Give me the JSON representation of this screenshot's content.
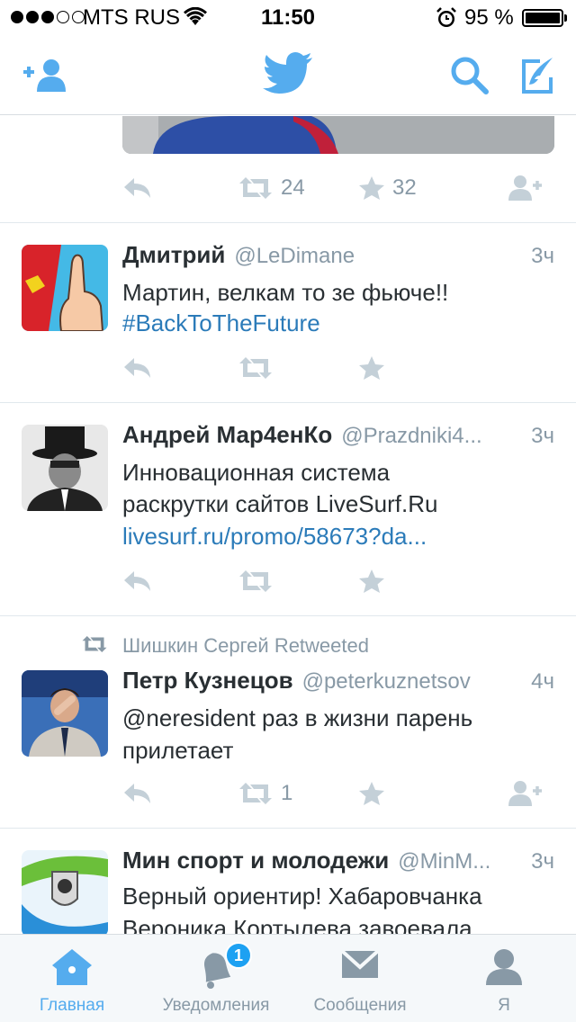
{
  "status_bar": {
    "carrier": "MTS RUS",
    "time": "11:50",
    "battery": "95 %"
  },
  "colors": {
    "accent": "#55acee",
    "text": "#292f33",
    "muted": "#8899a6",
    "link": "#2b7bb9",
    "action_icon": "#c4d0d8"
  },
  "nav": {
    "icons": [
      "add-user-icon",
      "twitter-bird-icon",
      "search-icon",
      "compose-icon"
    ]
  },
  "top_tweet": {
    "retweet_count": "24",
    "like_count": "32"
  },
  "tweets": [
    {
      "name": "Дмитрий",
      "handle": "@LeDimane",
      "time": "3ч",
      "lines": [
        "Мартин, велкам то зе фьюче!!",
        "#BackToTheFuture"
      ]
    },
    {
      "name": "Андрей Мар4енКо",
      "handle": "@Prazdniki4...",
      "time": "3ч",
      "lines": [
        "Инновационная система",
        "раскрутки сайтов LiveSurf.Ru"
      ],
      "link": "livesurf.ru/promo/58673?da..."
    },
    {
      "retweeted_by": "Шишкин Сергей Retweeted",
      "name": "Петр Кузнецов",
      "handle": "@peterkuznetsov",
      "time": "4ч",
      "lines": [
        "@neresident раз в жизни парень",
        "прилетает"
      ],
      "retweet_count": "1"
    },
    {
      "name": "Мин спорт и молодежи",
      "handle": "@MinM...",
      "time": "3ч",
      "lines": [
        "Верный ориентир! Хабаровчанка",
        "Вероника Кортылева завоевала"
      ]
    }
  ],
  "tab_bar": {
    "tabs": [
      {
        "label": "Главная",
        "icon": "home-icon"
      },
      {
        "label": "Уведомления",
        "icon": "bell-icon",
        "badge": "1"
      },
      {
        "label": "Сообщения",
        "icon": "envelope-icon"
      },
      {
        "label": "Я",
        "icon": "person-icon"
      }
    ]
  }
}
